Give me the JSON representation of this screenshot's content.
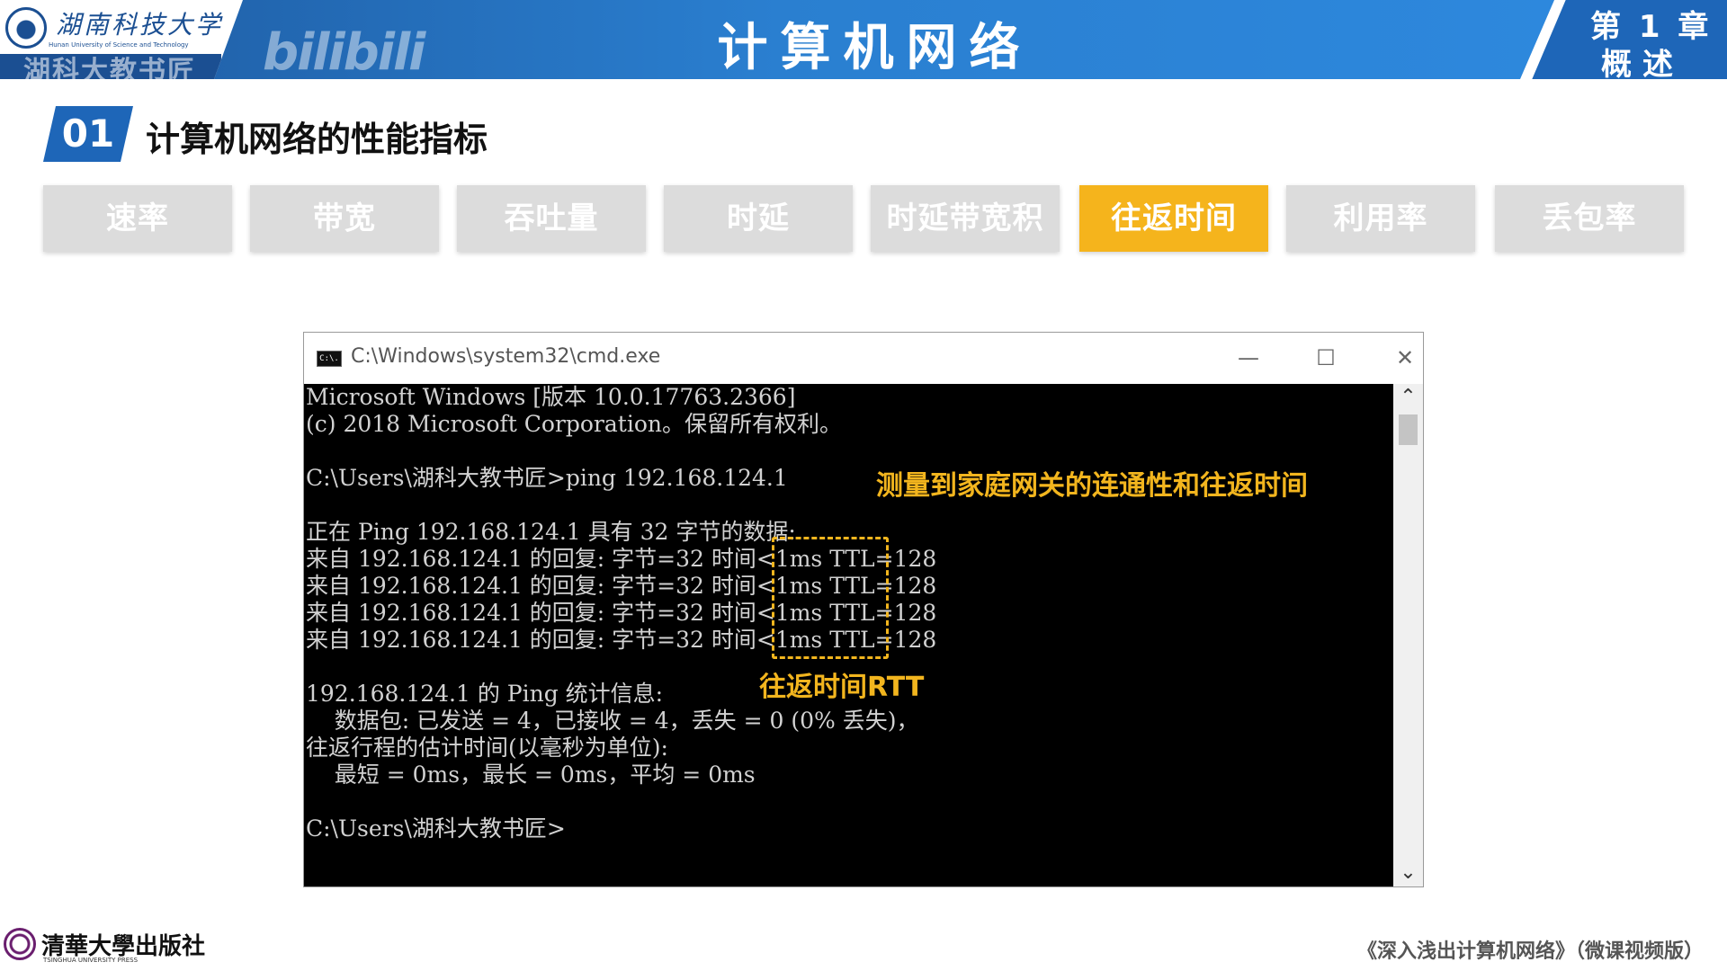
{
  "header": {
    "logo_cn": "湖南科技大学",
    "logo_en": "Hunan University of Science and Technology",
    "watermark": "湖科大教书匠",
    "bili_watermark": "bilibili",
    "title": "计算机网络",
    "chapter": "第 1 章",
    "chapter_sub": "概述"
  },
  "section": {
    "number": "01",
    "title": "计算机网络的性能指标"
  },
  "tabs": [
    {
      "label": "速率",
      "active": false
    },
    {
      "label": "带宽",
      "active": false
    },
    {
      "label": "吞吐量",
      "active": false
    },
    {
      "label": "时延",
      "active": false
    },
    {
      "label": "时延带宽积",
      "active": false
    },
    {
      "label": "往返时间",
      "active": true
    },
    {
      "label": "利用率",
      "active": false
    },
    {
      "label": "丢包率",
      "active": false
    }
  ],
  "colors": {
    "header_blue": "#2a7fd0",
    "tab_inactive": "#dcdcdc",
    "tab_active": "#f5b41c",
    "annotation": "#f2b51e"
  },
  "cmd": {
    "title": "C:\\Windows\\system32\\cmd.exe",
    "icon": "cmd-icon",
    "icon_text": "C:\\.",
    "minimize": "—",
    "maximize": "☐",
    "close": "✕",
    "lines": [
      "Microsoft Windows [版本 10.0.17763.2366]",
      "(c) 2018 Microsoft Corporation。保留所有权利。",
      "",
      "C:\\Users\\湖科大教书匠>ping 192.168.124.1",
      "",
      "正在 Ping 192.168.124.1 具有 32 字节的数据:",
      "来自 192.168.124.1 的回复: 字节=32 时间<1ms TTL=128",
      "来自 192.168.124.1 的回复: 字节=32 时间<1ms TTL=128",
      "来自 192.168.124.1 的回复: 字节=32 时间<1ms TTL=128",
      "来自 192.168.124.1 的回复: 字节=32 时间<1ms TTL=128",
      "",
      "192.168.124.1 的 Ping 统计信息:",
      "    数据包: 已发送 = 4，已接收 = 4，丢失 = 0 (0% 丢失)，",
      "往返行程的估计时间(以毫秒为单位):",
      "    最短 = 0ms，最长 = 0ms，平均 = 0ms",
      "",
      "C:\\Users\\湖科大教书匠>"
    ],
    "annotation_main": "测量到家庭网关的连通性和往返时间",
    "annotation_rtt": "往返时间RTT",
    "scroll_up": "⌃",
    "scroll_down": "⌄"
  },
  "footer": {
    "publisher": "清華大學出版社",
    "publisher_en": "TSINGHUA UNIVERSITY PRESS",
    "book": "《深入浅出计算机网络》（微课视频版）"
  }
}
